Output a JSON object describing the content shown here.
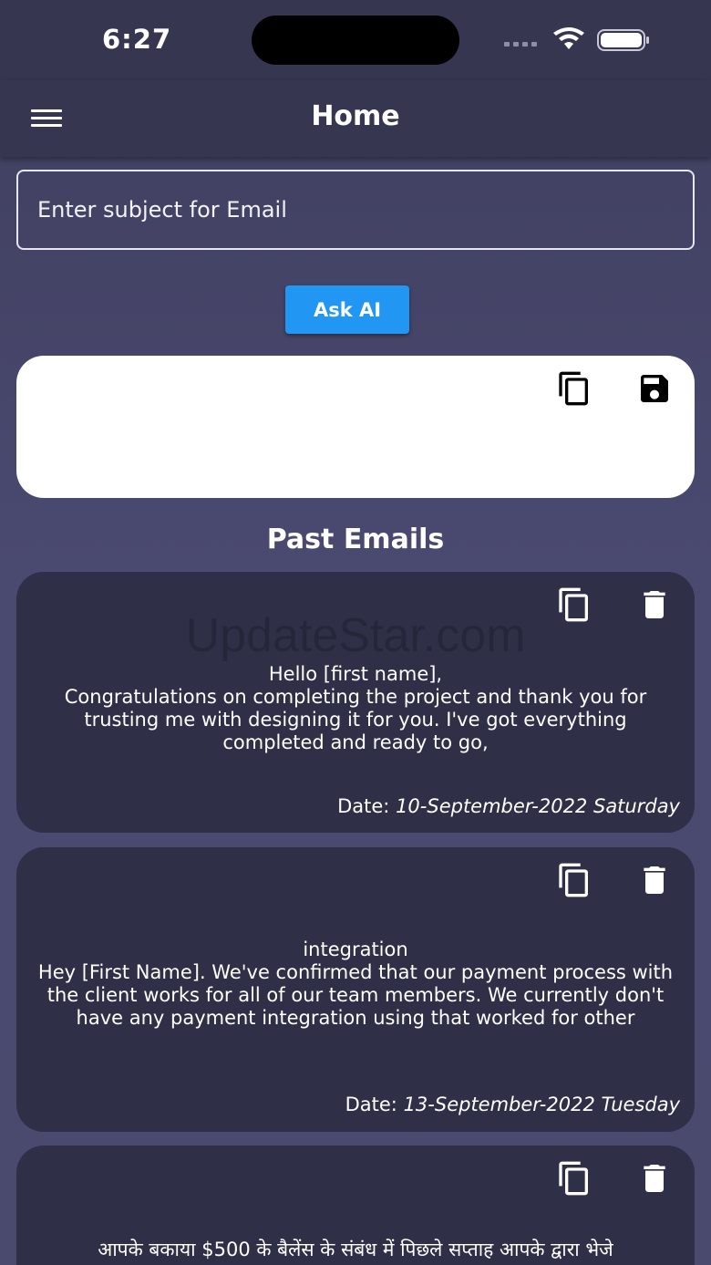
{
  "status": {
    "time": "6:27"
  },
  "app_bar": {
    "title": "Home"
  },
  "subject": {
    "placeholder": "Enter subject for Email"
  },
  "ask_button": {
    "label": "Ask AI"
  },
  "past_emails": {
    "title": "Past Emails",
    "date_label": "Date:",
    "items": [
      {
        "body": "Hello [first name],\nCongratulations on completing the project and thank you for trusting me with designing it for you. I've got everything completed and ready to go,",
        "date": "10-September-2022 Saturday"
      },
      {
        "body": "integration\nHey [First Name]. We've confirmed that our payment process with the client works for all of our team members. We currently don't have any payment integration using that worked for other",
        "date": "13-September-2022 Tuesday"
      },
      {
        "body": "आपके बकाया $500 के बैलेंस के संबंध में पिछले सप्ताह आपके द्वारा भेजे",
        "date": ""
      }
    ]
  },
  "watermark": "UpdateStar.com",
  "icons": {
    "copy": "copy-icon",
    "save": "save-icon",
    "delete": "delete-icon",
    "menu": "menu-icon"
  },
  "colors": {
    "accent": "#2196f3",
    "card": "#2f2f48",
    "app_bar": "#363650"
  }
}
